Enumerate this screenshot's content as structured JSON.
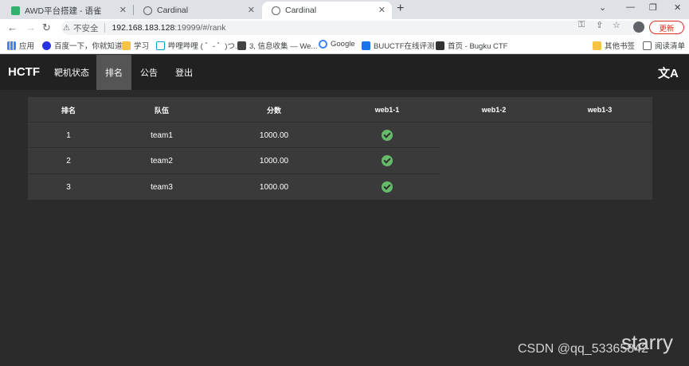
{
  "browser": {
    "tabs": [
      {
        "title": "AWD平台搭建 - 语雀",
        "icon": "yuque-icon"
      },
      {
        "title": "Cardinal",
        "icon": "globe-icon"
      },
      {
        "title": "Cardinal",
        "icon": "globe-icon",
        "active": true
      }
    ],
    "address": {
      "security_label": "不安全",
      "host": "192.168.183.128",
      "path": ":19999/#/rank"
    },
    "update_label": "更新",
    "bookmarks": [
      {
        "label": "应用",
        "icon": "apps-grid-icon"
      },
      {
        "label": "百度一下，你就知道",
        "icon": "baidu-icon"
      },
      {
        "label": "学习",
        "icon": "folder-icon"
      },
      {
        "label": "哔哩哔哩 ( ゜- ゜)つ...",
        "icon": "bilibili-icon"
      },
      {
        "label": "3, 信息收集 — We...",
        "icon": "book-icon"
      },
      {
        "label": "Google",
        "icon": "google-icon"
      },
      {
        "label": "BUUCTF在线评测",
        "icon": "buuctf-icon"
      },
      {
        "label": "首页 - Bugku CTF",
        "icon": "bugku-icon"
      },
      {
        "label": "其他书签",
        "icon": "folder-icon"
      },
      {
        "label": "阅读清单",
        "icon": "reading-list-icon"
      }
    ]
  },
  "app": {
    "brand": "HCTF",
    "nav": [
      "靶机状态",
      "排名",
      "公告",
      "登出"
    ],
    "active_nav": "排名"
  },
  "rank_table": {
    "headers": [
      "排名",
      "队伍",
      "分数",
      "web1-1",
      "web1-2",
      "web1-3"
    ],
    "rows": [
      {
        "rank": "1",
        "team": "team1",
        "score": "1000.00",
        "web1_1": "check",
        "web1_2": "",
        "web1_3": ""
      },
      {
        "rank": "2",
        "team": "team2",
        "score": "1000.00",
        "web1_1": "check",
        "web1_2": "",
        "web1_3": ""
      },
      {
        "rank": "3",
        "team": "team3",
        "score": "1000.00",
        "web1_1": "check",
        "web1_2": "",
        "web1_3": ""
      }
    ]
  },
  "watermark": "CSDN @qq_53365842",
  "overlay_text": "starry",
  "colors": {
    "nav_bg": "#212121",
    "active_nav": "#555555",
    "page_bg": "#2b2b2b",
    "table_bg": "#3a3a3a",
    "check": "#66bb6a",
    "update": "#d93025"
  }
}
